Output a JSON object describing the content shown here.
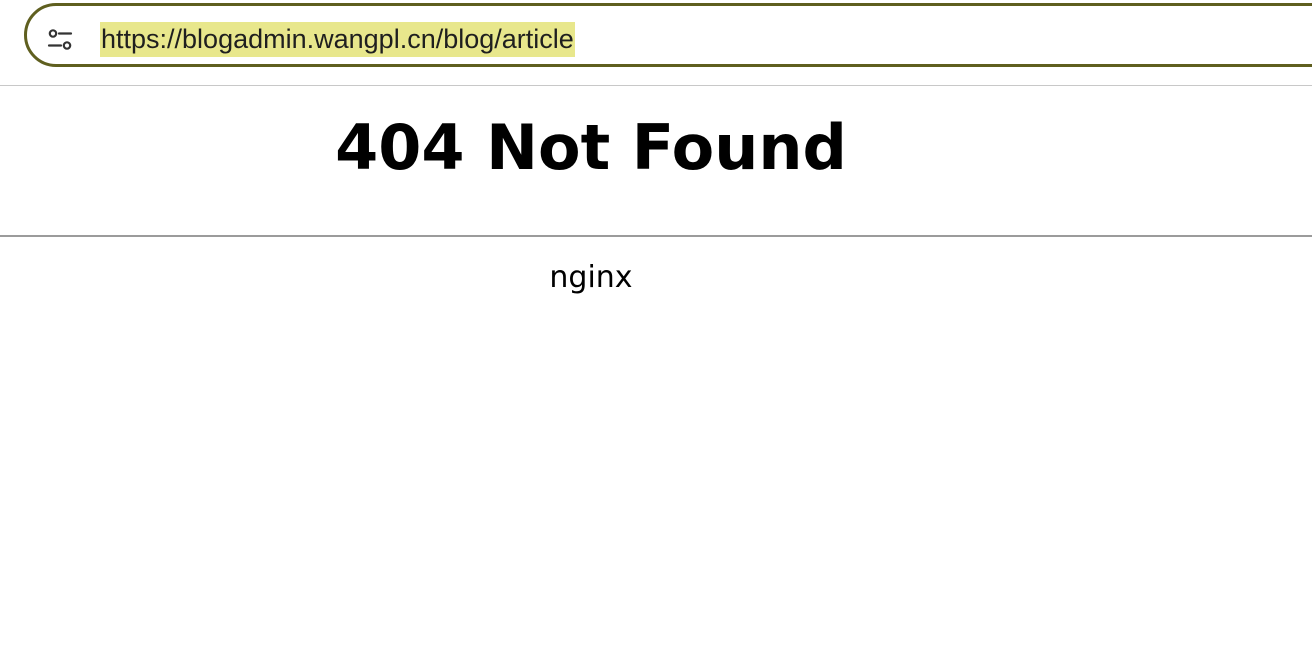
{
  "browser": {
    "address_bar": {
      "url": "https://blogadmin.wangpl.cn/blog/article",
      "url_selected": true,
      "site_info_icon": "tune-icon"
    },
    "colors": {
      "omnibox_border": "#5f5f1f",
      "url_highlight": "#e8e78c"
    }
  },
  "page": {
    "title": "404 Not Found",
    "server": "nginx"
  }
}
